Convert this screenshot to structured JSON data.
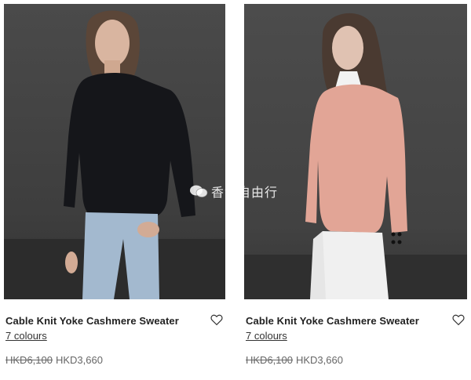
{
  "products": [
    {
      "title": "Cable Knit Yoke Cashmere Sweater",
      "colours": "7 colours",
      "original_price": "HKD6,100",
      "sale_price": "HKD3,660",
      "sweater_color": "#15161a"
    },
    {
      "title": "Cable Knit Yoke Cashmere Sweater",
      "colours": "7 colours",
      "original_price": "HKD6,100",
      "sale_price": "HKD3,660",
      "sweater_color": "#e2a596"
    }
  ],
  "watermark": {
    "text": "香港自由行"
  },
  "colors": {
    "text": "#222222",
    "muted": "#666666",
    "photo_bg": "#444444"
  }
}
